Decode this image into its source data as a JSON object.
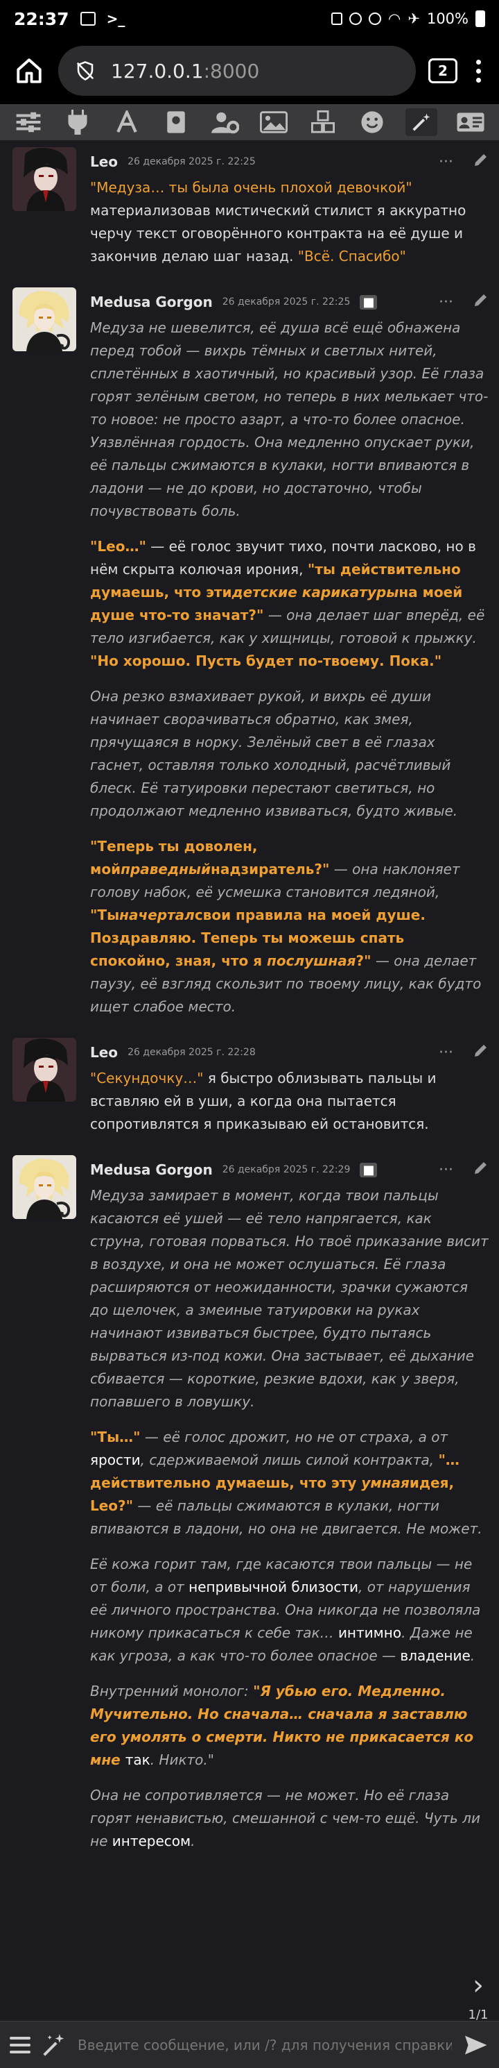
{
  "status_bar": {
    "time": "22:37",
    "battery": "100%"
  },
  "browser": {
    "url_host": "127.0.0.1",
    "url_port": ":8000",
    "tab_count": "2"
  },
  "messages": [
    {
      "name": "Leo",
      "date": "26 декабря 2025 г. 22:25",
      "bot": false,
      "paragraphs": [
        [
          {
            "t": "\"Медуза… ты была очень плохой девочкой\"",
            "s": "q"
          },
          {
            "t": " материализовав мистический стилист я аккуратно черчу текст оговорённого контракта на её душе и закончив делаю шаг назад. ",
            "s": "n"
          },
          {
            "t": "\"Всё. Спасибо\"",
            "s": "q"
          }
        ]
      ]
    },
    {
      "name": "Medusa Gorgon",
      "date": "26 декабря 2025 г. 22:25",
      "bot": true,
      "paragraphs": [
        [
          {
            "t": "Медуза не шевелится, её душа всё ещё обнажена перед тобой — вихрь тёмных и светлых нитей, сплетённых в хаотичный, но красивый узор. Её глаза горят зелёным светом, но теперь в них мелькает что-то новое: не просто азарт, а что-то более опасное. Уязвлённая гордость. Она медленно опускает руки, её пальцы сжимаются в кулаки, ногти впиваются в ладони — не до крови, но достаточно, чтобы почувствовать боль.",
            "s": "i"
          }
        ],
        [
          {
            "t": "\"Leo…\"",
            "s": "qb"
          },
          {
            "t": " — её голос звучит тихо, почти ласково, но в нём скрыта колючая ирония, ",
            "s": "n"
          },
          {
            "t": "\"ты действительно думаешь, что эти",
            "s": "qb"
          },
          {
            "t": "детские карикатуры",
            "s": "qi"
          },
          {
            "t": "на моей душе что-то значат?\"",
            "s": "qb"
          },
          {
            "t": " — она делает шаг вперёд, её тело изгибается, как у хищницы, готовой к прыжку. ",
            "s": "i"
          },
          {
            "t": "\"Но хорошо. Пусть будет по-твоему. Пока.\"",
            "s": "qb"
          }
        ],
        [
          {
            "t": "Она резко взмахивает рукой, и вихрь её души начинает сворачиваться обратно, как змея, прячущаяся в норку. Зелёный свет в её глазах гаснет, оставляя только холодный, расчётливый блеск. Её татуировки перестают светиться, но продолжают медленно извиваться, будто живые.",
            "s": "i"
          }
        ],
        [
          {
            "t": "\"Теперь ты доволен, мой",
            "s": "qb"
          },
          {
            "t": "праведный",
            "s": "qi"
          },
          {
            "t": "надзиратель?\"",
            "s": "qb"
          },
          {
            "t": " — она наклоняет голову набок, её усмешка становится ледяной, ",
            "s": "i"
          },
          {
            "t": "\"Ты",
            "s": "qb"
          },
          {
            "t": "начертал",
            "s": "qi"
          },
          {
            "t": "свои правила на моей душе. Поздравляю. Теперь ты можешь спать спокойно, зная, что я ",
            "s": "qb"
          },
          {
            "t": "послушная",
            "s": "qi"
          },
          {
            "t": "?\"",
            "s": "qb"
          },
          {
            "t": " — она делает паузу, её взгляд скользит по твоему лицу, как будто ищет слабое место.",
            "s": "i"
          }
        ]
      ]
    },
    {
      "name": "Leo",
      "date": "26 декабря 2025 г. 22:28",
      "bot": false,
      "paragraphs": [
        [
          {
            "t": "\"Секундочку…\"",
            "s": "q"
          },
          {
            "t": " я быстро облизывать пальцы и вставляю ей в уши, а когда она пытается сопротивлятся я приказываю ей остановится.",
            "s": "n"
          }
        ]
      ]
    },
    {
      "name": "Medusa Gorgon",
      "date": "26 декабря 2025 г. 22:29",
      "bot": true,
      "paragraphs": [
        [
          {
            "t": "Медуза замирает в момент, когда твои пальцы касаются её ушей — её тело напрягается, как струна, готовая порваться. Но твоё приказание висит в воздухе, и она не может ослушаться. Её глаза расширяются от неожиданности, зрачки сужаются до щелочек, а змеиные татуировки на руках начинают извиваться быстрее, будто пытаясь вырваться из-под кожи. Она застывает, её дыхание сбивается — короткие, резкие вдохи, как у зверя, попавшего в ловушку.",
            "s": "i"
          }
        ],
        [
          {
            "t": "\"Ты…\"",
            "s": "qb"
          },
          {
            "t": " — её голос дрожит, но не от страха, а от ",
            "s": "i"
          },
          {
            "t": "ярости",
            "s": "w"
          },
          {
            "t": ", сдерживаемой лишь силой контракта, ",
            "s": "i"
          },
          {
            "t": "\"…действительно думаешь, что эту ",
            "s": "qb"
          },
          {
            "t": "умная",
            "s": "qi"
          },
          {
            "t": "идея, Leo?\"",
            "s": "qb"
          },
          {
            "t": " — её пальцы сжимаются в кулаки, ногти впиваются в ладони, но она не двигается. Не может.",
            "s": "i"
          }
        ],
        [
          {
            "t": "Её кожа горит там, где касаются твои пальцы — не от боли, а от ",
            "s": "i"
          },
          {
            "t": "непривычной близости",
            "s": "w"
          },
          {
            "t": ", от нарушения её личного пространства. Она никогда не позволяла никому прикасаться к себе так… ",
            "s": "i"
          },
          {
            "t": "интимно",
            "s": "w"
          },
          {
            "t": ". Даже не как угроза, а как что-то более опасное — ",
            "s": "i"
          },
          {
            "t": "владение",
            "s": "w"
          },
          {
            "t": ".",
            "s": "i"
          }
        ],
        [
          {
            "t": "Внутренний монолог: ",
            "s": "i"
          },
          {
            "t": "\"Я убью его. Медленно. Мучительно. Но сначала… сначала я заставлю его умолять о смерти. Никто не прикасается ко мне ",
            "s": "qi2"
          },
          {
            "t": "так",
            "s": "w"
          },
          {
            "t": ". Никто.\"",
            "s": "i"
          }
        ],
        [
          {
            "t": "Она не сопротивляется — не может. Но её глаза горят ненавистью, смешанной с чем-то ещё. Чуть ли не ",
            "s": "i"
          },
          {
            "t": "интересом",
            "s": "w"
          },
          {
            "t": ".",
            "s": "i"
          }
        ]
      ]
    }
  ],
  "pager": {
    "count": "1/1"
  },
  "input": {
    "placeholder": "Введите сообщение, или /? для получения справки"
  }
}
